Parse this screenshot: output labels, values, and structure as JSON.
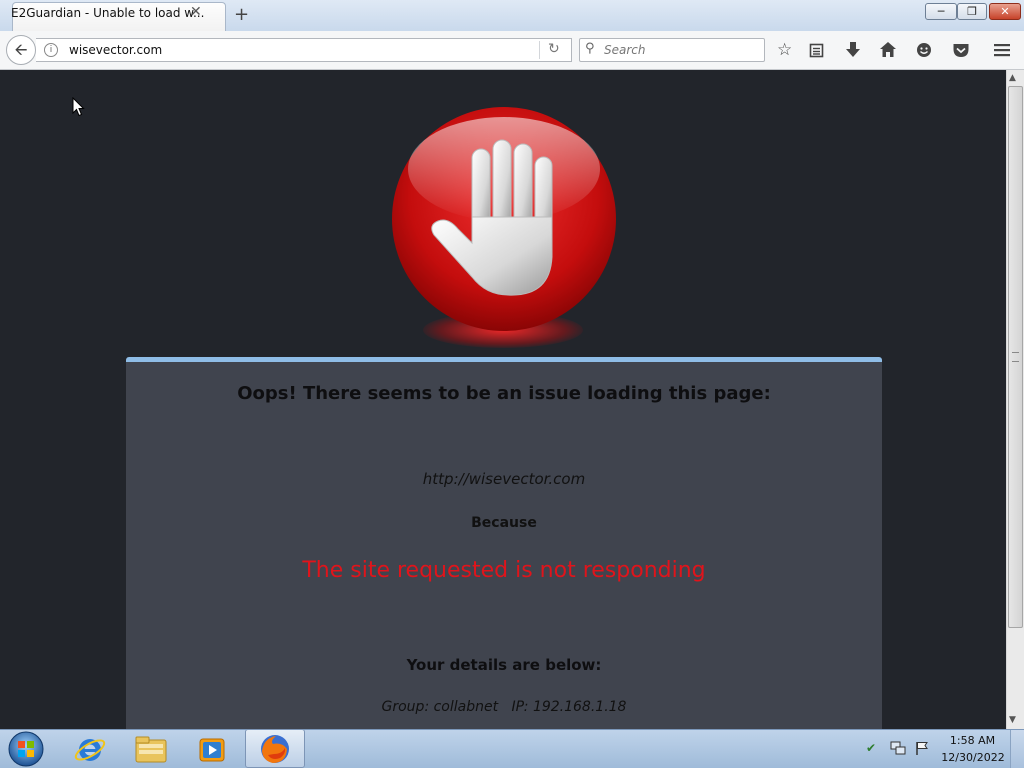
{
  "browser": {
    "tab_title": "E2Guardian - Unable to load w...",
    "tab_close_glyph": "✕",
    "new_tab_glyph": "+",
    "url": "wisevector.com",
    "search_placeholder": "Search"
  },
  "page": {
    "heading": "Oops! There seems to be an issue loading this page:",
    "blocked_url": "http://wisevector.com",
    "because_label": "Because",
    "reason": "The site requested is not responding",
    "details_heading": "Your details are below:",
    "details_line": "Group: collabnet   IP: 192.168.1.18"
  },
  "taskbar": {
    "time": "1:58 AM",
    "date": "12/30/2022"
  },
  "icons": [
    "back-arrow-icon",
    "info-icon",
    "reload-icon",
    "search-icon",
    "bookmark-star-icon",
    "reading-list-icon",
    "download-icon",
    "home-icon",
    "smiley-icon",
    "pocket-icon",
    "menu-icon",
    "stop-hand-icon",
    "windows-start-icon",
    "ie-icon",
    "explorer-icon",
    "media-player-icon",
    "firefox-icon",
    "shield-icon",
    "network-icon",
    "flag-icon"
  ],
  "colors": {
    "page_bg": "#22252b",
    "panel_bg": "#40444e",
    "panel_top_border": "#8fbde7",
    "reason_text": "#e0141b"
  }
}
